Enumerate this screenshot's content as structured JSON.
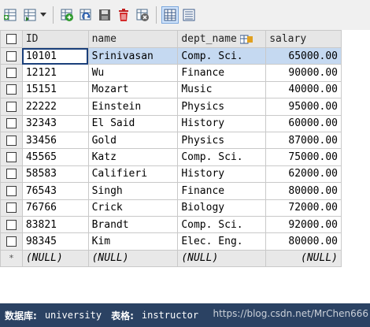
{
  "columns": [
    {
      "label": "ID"
    },
    {
      "label": "name"
    },
    {
      "label": "dept_name"
    },
    {
      "label": "salary"
    }
  ],
  "rows": [
    {
      "id": "10101",
      "name": "Srinivasan",
      "dept_name": "Comp. Sci.",
      "salary": "65000.00"
    },
    {
      "id": "12121",
      "name": "Wu",
      "dept_name": "Finance",
      "salary": "90000.00"
    },
    {
      "id": "15151",
      "name": "Mozart",
      "dept_name": "Music",
      "salary": "40000.00"
    },
    {
      "id": "22222",
      "name": "Einstein",
      "dept_name": "Physics",
      "salary": "95000.00"
    },
    {
      "id": "32343",
      "name": "El Said",
      "dept_name": "History",
      "salary": "60000.00"
    },
    {
      "id": "33456",
      "name": "Gold",
      "dept_name": "Physics",
      "salary": "87000.00"
    },
    {
      "id": "45565",
      "name": "Katz",
      "dept_name": "Comp. Sci.",
      "salary": "75000.00"
    },
    {
      "id": "58583",
      "name": "Califieri",
      "dept_name": "History",
      "salary": "62000.00"
    },
    {
      "id": "76543",
      "name": "Singh",
      "dept_name": "Finance",
      "salary": "80000.00"
    },
    {
      "id": "76766",
      "name": "Crick",
      "dept_name": "Biology",
      "salary": "72000.00"
    },
    {
      "id": "83821",
      "name": "Brandt",
      "dept_name": "Comp. Sci.",
      "salary": "92000.00"
    },
    {
      "id": "98345",
      "name": "Kim",
      "dept_name": "Elec. Eng.",
      "salary": "80000.00"
    }
  ],
  "new_row": {
    "marker": "*",
    "id": "(NULL)",
    "name": "(NULL)",
    "dept_name": "(NULL)",
    "salary": "(NULL)"
  },
  "selected_row_index": 0,
  "status": {
    "db_label": "数据库:",
    "db_value": "university",
    "table_label": "表格:",
    "table_value": "instructor",
    "watermark": "https://blog.csdn.net/MrChen666"
  },
  "toolbar_icons": [
    "insert-row-icon",
    "duplicate-row-icon",
    "add-record-icon",
    "refresh-icon",
    "save-icon",
    "delete-icon",
    "cancel-icon",
    "grid-view-icon",
    "text-view-icon"
  ],
  "colors": {
    "selection": "#c5d9f1",
    "statusbar": "#2b4263",
    "header": "#e6e6e6"
  }
}
